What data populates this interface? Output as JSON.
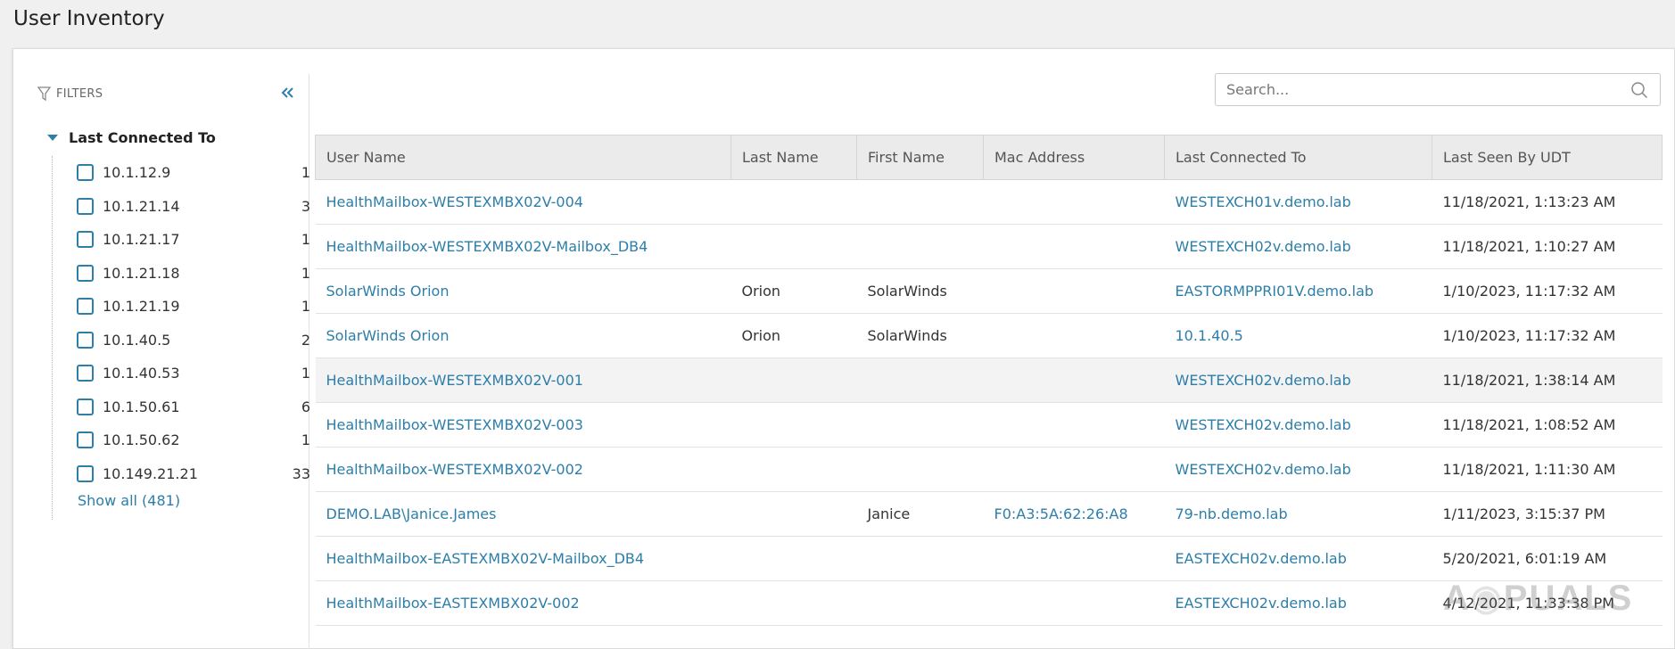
{
  "page": {
    "title": "User Inventory"
  },
  "filters": {
    "header": "FILTERS",
    "group_title": "Last Connected To",
    "items": [
      {
        "label": "10.1.12.9",
        "count": "1"
      },
      {
        "label": "10.1.21.14",
        "count": "3"
      },
      {
        "label": "10.1.21.17",
        "count": "1"
      },
      {
        "label": "10.1.21.18",
        "count": "1"
      },
      {
        "label": "10.1.21.19",
        "count": "1"
      },
      {
        "label": "10.1.40.5",
        "count": "2"
      },
      {
        "label": "10.1.40.53",
        "count": "1"
      },
      {
        "label": "10.1.50.61",
        "count": "6"
      },
      {
        "label": "10.1.50.62",
        "count": "1"
      },
      {
        "label": "10.149.21.21",
        "count": "33"
      }
    ],
    "show_all": "Show all (481)"
  },
  "search": {
    "placeholder": "Search..."
  },
  "table": {
    "columns": [
      "User Name",
      "Last Name",
      "First Name",
      "Mac Address",
      "Last Connected To",
      "Last Seen By UDT"
    ],
    "rows": [
      [
        "HealthMailbox-WESTEXMBX02V-004",
        "",
        "",
        "",
        "WESTEXCH01v.demo.lab",
        "11/18/2021, 1:13:23 AM"
      ],
      [
        "HealthMailbox-WESTEXMBX02V-Mailbox_DB4",
        "",
        "",
        "",
        "WESTEXCH02v.demo.lab",
        "11/18/2021, 1:10:27 AM"
      ],
      [
        "SolarWinds Orion",
        "Orion",
        "SolarWinds",
        "",
        "EASTORMPPRI01V.demo.lab",
        "1/10/2023, 11:17:32 AM"
      ],
      [
        "SolarWinds Orion",
        "Orion",
        "SolarWinds",
        "",
        "10.1.40.5",
        "1/10/2023, 11:17:32 AM"
      ],
      [
        "HealthMailbox-WESTEXMBX02V-001",
        "",
        "",
        "",
        "WESTEXCH02v.demo.lab",
        "11/18/2021, 1:38:14 AM"
      ],
      [
        "HealthMailbox-WESTEXMBX02V-003",
        "",
        "",
        "",
        "WESTEXCH02v.demo.lab",
        "11/18/2021, 1:08:52 AM"
      ],
      [
        "HealthMailbox-WESTEXMBX02V-002",
        "",
        "",
        "",
        "WESTEXCH02v.demo.lab",
        "11/18/2021, 1:11:30 AM"
      ],
      [
        "DEMO.LAB\\Janice.James",
        "",
        "Janice",
        "F0:A3:5A:62:26:A8",
        "79-nb.demo.lab",
        "1/11/2023, 3:15:37 PM"
      ],
      [
        "HealthMailbox-EASTEXMBX02V-Mailbox_DB4",
        "",
        "",
        "",
        "EASTEXCH02v.demo.lab",
        "5/20/2021, 6:01:19 AM"
      ],
      [
        "HealthMailbox-EASTEXMBX02V-002",
        "",
        "",
        "",
        "EASTEXCH02v.demo.lab",
        "4/12/2021, 11:33:38 PM"
      ]
    ]
  },
  "watermark": "APPUALS",
  "colors": {
    "accent": "#2d7ea8",
    "header_bg": "#ebebeb"
  },
  "icons": {
    "filter": "funnel-icon",
    "collapse": "double-chevron-left-icon",
    "search": "search-icon",
    "caret": "caret-down-icon"
  }
}
